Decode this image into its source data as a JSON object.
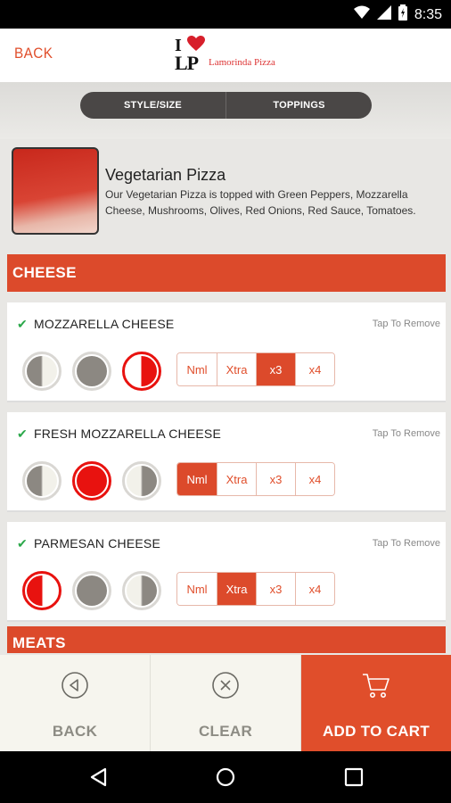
{
  "status_bar": {
    "time": "8:35",
    "icons": [
      "wifi-icon",
      "signal-icon",
      "battery-icon"
    ]
  },
  "header": {
    "back_label": "BACK",
    "logo_i": "I",
    "logo_lp": "LP",
    "logo_name": "Lamorinda Pizza"
  },
  "tabs": [
    {
      "label": "STYLE/SIZE"
    },
    {
      "label": "TOPPINGS"
    }
  ],
  "pizza": {
    "title": "Vegetarian Pizza",
    "description": "Our Vegetarian Pizza is topped with Green Peppers, Mozzarella Cheese, Mushrooms, Olives, Red Onions, Red Sauce, Tomatoes."
  },
  "sections": {
    "cheese": "CHEESE",
    "meats": "MEATS"
  },
  "toppings": [
    {
      "name": "MOZZARELLA CHEESE",
      "remove_label": "Tap To Remove",
      "coverage_selected": "right-half",
      "amount_options": [
        "Nml",
        "Xtra",
        "x3",
        "x4"
      ],
      "amount_selected": "x3"
    },
    {
      "name": "FRESH MOZZARELLA CHEESE",
      "remove_label": "Tap To Remove",
      "coverage_selected": "whole",
      "amount_options": [
        "Nml",
        "Xtra",
        "x3",
        "x4"
      ],
      "amount_selected": "Nml"
    },
    {
      "name": "PARMESAN CHEESE",
      "remove_label": "Tap To Remove",
      "coverage_selected": "left-half",
      "amount_options": [
        "Nml",
        "Xtra",
        "x3",
        "x4"
      ],
      "amount_selected": "Xtra"
    }
  ],
  "bottom_bar": {
    "back_label": "BACK",
    "clear_label": "CLEAR",
    "cart_label": "ADD TO CART"
  },
  "colors": {
    "accent": "#dc4a2b",
    "check": "#2ba84a",
    "tab_bg": "#4a4746",
    "selected_coverage": "#e8120f",
    "unselected_coverage": "#8c8882"
  }
}
